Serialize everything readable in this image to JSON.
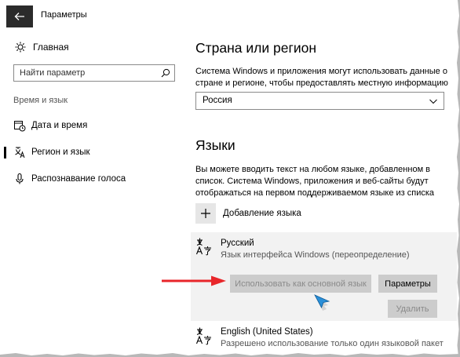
{
  "window": {
    "title": "Параметры"
  },
  "sidebar": {
    "home_label": "Главная",
    "search_placeholder": "Найти параметр",
    "section_label": "Время и язык",
    "items": [
      {
        "label": "Дата и время",
        "icon": "calendar-clock-icon",
        "selected": false
      },
      {
        "label": "Регион и язык",
        "icon": "region-language-icon",
        "selected": true
      },
      {
        "label": "Распознавание голоса",
        "icon": "microphone-icon",
        "selected": false
      }
    ]
  },
  "main": {
    "country": {
      "heading": "Страна или регион",
      "description": "Система Windows и приложения могут использовать данные о стране и регионе, чтобы предоставлять местную информацию",
      "selected_value": "Россия"
    },
    "languages": {
      "heading": "Языки",
      "description": "Вы можете вводить текст на любом языке, добавленном в список. Система Windows, приложения и веб-сайты будут отображаться на первом поддерживаемом языке из списка",
      "add_label": "Добавление языка",
      "list": [
        {
          "name": "Русский",
          "subtitle": "Язык интерфейса Windows (переопределение)",
          "actions": {
            "set_default": "Использовать как основной язык",
            "options": "Параметры",
            "remove": "Удалить"
          }
        },
        {
          "name": "English (United States)",
          "subtitle": "Разрешено использование только один языковой пакет"
        }
      ]
    }
  },
  "colors": {
    "annotation_arrow": "#e8262a",
    "selected_item_bg": "#f2f2f2",
    "button_bg": "#cccccc",
    "back_button_bg": "#2b2b2b"
  }
}
